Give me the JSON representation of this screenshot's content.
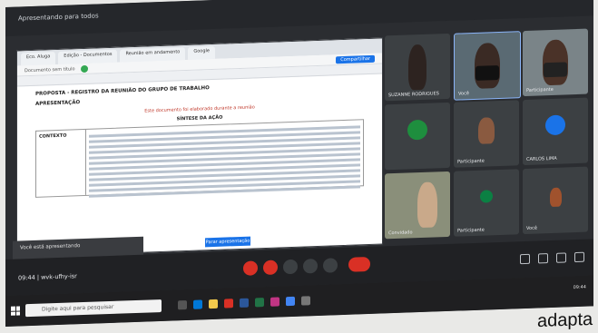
{
  "meeting": {
    "presenter_banner": "Apresentando para todos",
    "time": "09:44",
    "meeting_code": "wvk-ufhy-isr"
  },
  "browser": {
    "tabs": [
      "Eco. Aluga",
      "Edição - Documentos",
      "Reunião em andamento",
      "Google"
    ],
    "doc_title": "Documento sem título",
    "share_label": "Compartilhar"
  },
  "document": {
    "heading": "PROPOSTA - REGISTRO DA REUNIÃO DO GRUPO DE TRABALHO",
    "subheading": "APRESENTAÇÃO",
    "red_line": "Este documento foi elaborado durante a reunião",
    "table_title": "SÍNTESE DA AÇÃO",
    "row_label": "CONTEXTO"
  },
  "toast": {
    "text": "Você está apresentando"
  },
  "blue_button": "Parar apresentação",
  "tiles": [
    {
      "name": "SUZANNE RODRIGUES",
      "type": "photo",
      "color": "#3c4043"
    },
    {
      "name": "Você",
      "type": "masked",
      "color": "#5a6a73"
    },
    {
      "name": "Participante",
      "type": "masked",
      "color": "#7a8488"
    },
    {
      "name": "",
      "type": "avatar",
      "letter": "",
      "color": "#1e8e3e"
    },
    {
      "name": "Participante",
      "type": "photo",
      "color": "#3c4043"
    },
    {
      "name": "CARLOS LIMA",
      "type": "avatar",
      "letter": "",
      "color": "#1a73e8"
    },
    {
      "name": "Convidado",
      "type": "photo",
      "color": "#8a8f7a"
    },
    {
      "name": "Participante",
      "type": "photo",
      "color": "#3c4043"
    },
    {
      "name": "Você",
      "type": "photo",
      "color": "#3c4043"
    }
  ],
  "taskbar": {
    "search_placeholder": "Digite aqui para pesquisar",
    "clock": "09:44"
  },
  "handwritten": "adapta"
}
